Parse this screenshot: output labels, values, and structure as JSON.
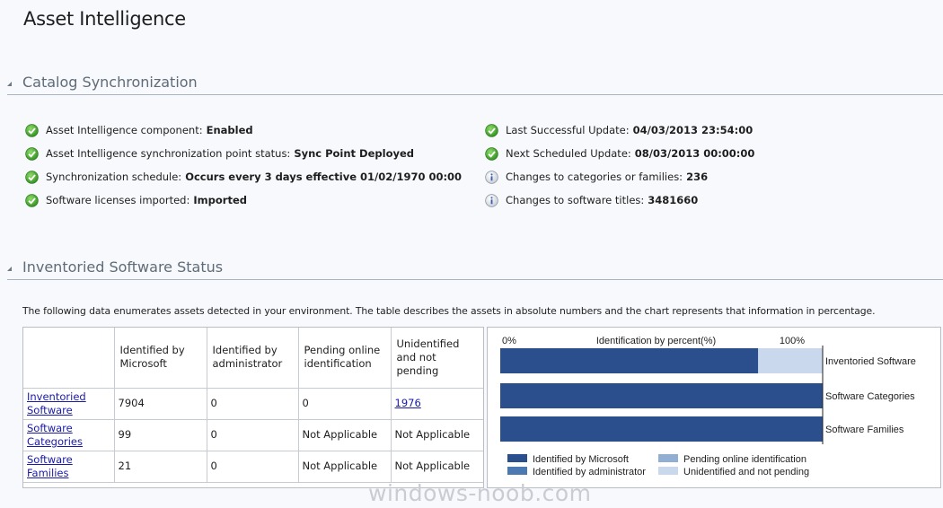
{
  "page_title": "Asset Intelligence",
  "catalog": {
    "title": "Catalog Synchronization",
    "left_items": [
      {
        "icon": "check-icon",
        "label": "Asset Intelligence component:",
        "value": "Enabled"
      },
      {
        "icon": "check-icon",
        "label": "Asset Intelligence synchronization point status:",
        "value": "Sync Point Deployed"
      },
      {
        "icon": "check-icon",
        "label": "Synchronization schedule:",
        "value": "Occurs every 3 days effective 01/02/1970 00:00"
      },
      {
        "icon": "check-icon",
        "label": "Software licenses imported:",
        "value": "Imported"
      }
    ],
    "right_items": [
      {
        "icon": "check-icon",
        "label": "Last Successful Update:",
        "value": "04/03/2013 23:54:00"
      },
      {
        "icon": "check-icon",
        "label": "Next Scheduled Update:",
        "value": "08/03/2013 00:00:00"
      },
      {
        "icon": "info-icon",
        "label": "Changes to categories or families:",
        "value": "236"
      },
      {
        "icon": "info-icon",
        "label": "Changes to software titles:",
        "value": "3481660"
      }
    ]
  },
  "inventoried": {
    "title": "Inventoried Software Status",
    "description": "The following data enumerates assets detected in your environment. The table describes the assets in absolute numbers and the chart represents that information in percentage.",
    "table": {
      "headers": [
        "",
        "Identified by Microsoft",
        "Identified by administrator",
        "Pending online identification",
        "Unidentified and not pending"
      ],
      "rows": [
        {
          "name": "Inventoried Software",
          "ms": "7904",
          "admin": "0",
          "pending": "0",
          "unidentified": "1976",
          "unidentified_link": true
        },
        {
          "name": "Software Categories",
          "ms": "99",
          "admin": "0",
          "pending": "Not Applicable",
          "unidentified": "Not Applicable",
          "unidentified_link": false
        },
        {
          "name": "Software Families",
          "ms": "21",
          "admin": "0",
          "pending": "Not Applicable",
          "unidentified": "Not Applicable",
          "unidentified_link": false
        }
      ]
    }
  },
  "chart_data": {
    "type": "bar",
    "orientation": "horizontal",
    "stacked": true,
    "title": "Identification by percent(%)",
    "x_tick_labels": [
      "0%",
      "100%"
    ],
    "xlim": [
      0,
      100
    ],
    "categories": [
      "Inventoried Software",
      "Software Categories",
      "Software Families"
    ],
    "series": [
      {
        "name": "Identified by Microsoft",
        "color": "#2a4f8c",
        "values": [
          80,
          100,
          100
        ]
      },
      {
        "name": "Identified by administrator",
        "color": "#4d79b3",
        "values": [
          0,
          0,
          0
        ]
      },
      {
        "name": "Pending online identification",
        "color": "#93aed3",
        "values": [
          0,
          0,
          0
        ]
      },
      {
        "name": "Unidentified and not pending",
        "color": "#c9d8ec",
        "values": [
          20,
          0,
          0
        ]
      }
    ],
    "legend_position": "bottom"
  },
  "watermark": "windows-noob.com"
}
